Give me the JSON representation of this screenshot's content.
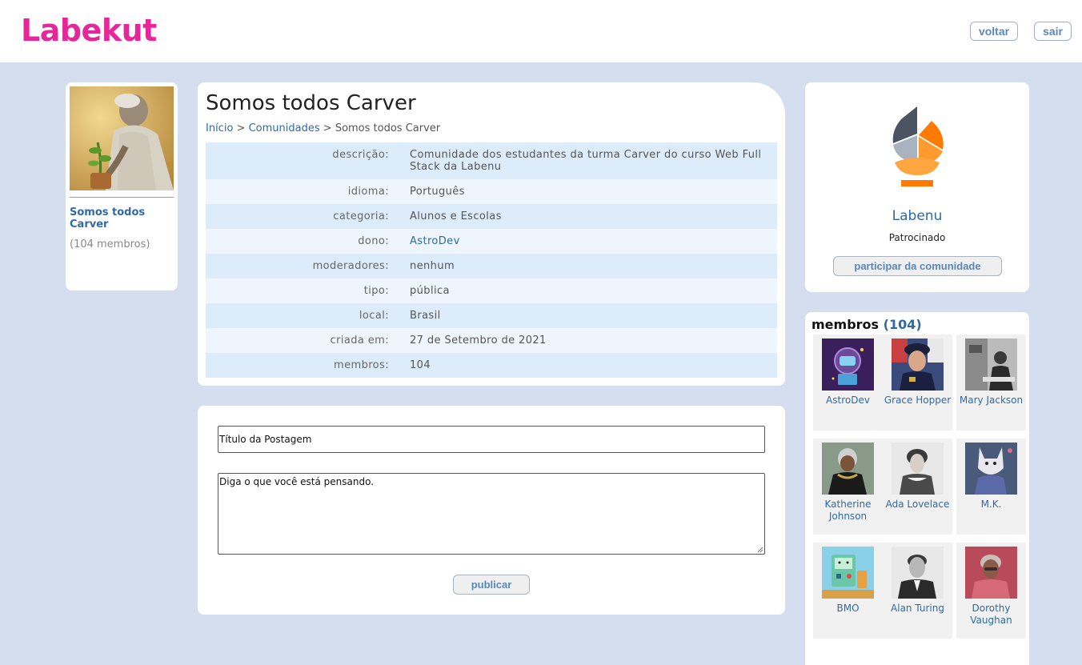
{
  "header": {
    "logo": "Labekut",
    "back_label": "voltar",
    "logout_label": "sair",
    "accent_color": "#e6279a"
  },
  "profile": {
    "name": "Somos todos Carver",
    "members": "(104 membros)"
  },
  "community": {
    "title": "Somos todos Carver",
    "breadcrumb": {
      "home": "Início",
      "sep1": ">",
      "communities": "Comunidades",
      "sep2": ">",
      "current": "Somos todos Carver"
    },
    "info": [
      {
        "label": "descrição:",
        "value": "Comunidade dos estudantes da turma Carver do curso Web Full Stack da Labenu"
      },
      {
        "label": "idioma:",
        "value": "Português"
      },
      {
        "label": "categoria:",
        "value": "Alunos e Escolas"
      },
      {
        "label": "dono:",
        "value": "AstroDev"
      },
      {
        "label": "moderadores:",
        "value": "nenhum"
      },
      {
        "label": "tipo:",
        "value": "pública"
      },
      {
        "label": "local:",
        "value": "Brasil"
      },
      {
        "label": "criada em:",
        "value": "27 de Setembro de 2021"
      },
      {
        "label": "membros:",
        "value": "104"
      }
    ]
  },
  "post": {
    "title_placeholder": "Título da Postagem",
    "body_placeholder": "Diga o que você está pensando.",
    "publish_label": "publicar"
  },
  "sponsor": {
    "name": "Labenu",
    "tag": "Patrocinado",
    "join_label": "participar da comunidade"
  },
  "members_box": {
    "title": "membros",
    "count": "(104)",
    "items": [
      {
        "name": "AstroDev"
      },
      {
        "name": "Grace Hopper"
      },
      {
        "name": "Mary Jackson"
      },
      {
        "name": "Katherine Johnson"
      },
      {
        "name": "Ada Lovelace"
      },
      {
        "name": "M.K."
      },
      {
        "name": "BMO"
      },
      {
        "name": "Alan Turing"
      },
      {
        "name": "Dorothy Vaughan"
      }
    ]
  }
}
